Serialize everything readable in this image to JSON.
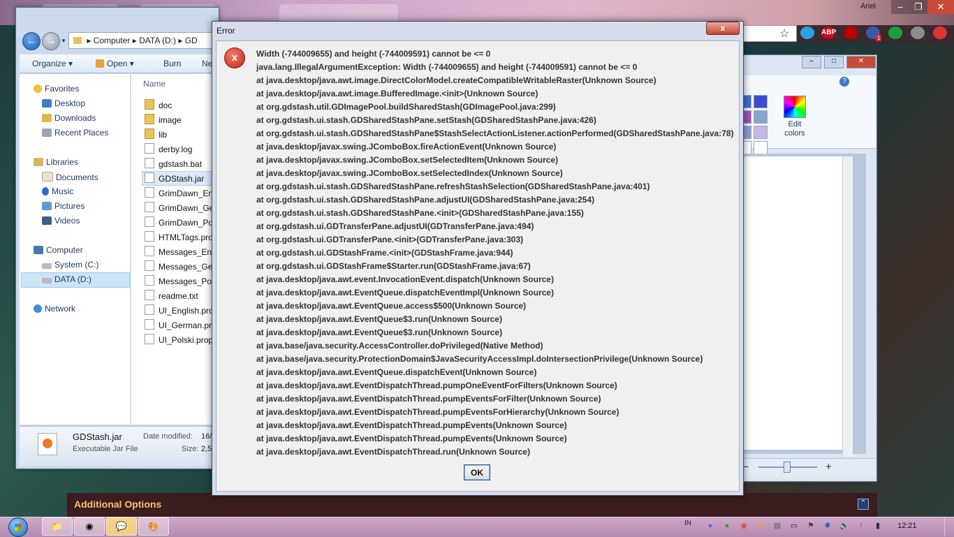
{
  "browser": {
    "tabs": [
      "",
      "",
      ""
    ],
    "account_name": "Ariel",
    "window_controls": [
      "–",
      "❐",
      "✕"
    ],
    "extensions": [
      {
        "name": "pinwheel-icon",
        "color": "#2aa1e0",
        "glyph": ""
      },
      {
        "name": "adblock-plus-icon",
        "color": "#d0021b",
        "glyph": "ABP"
      },
      {
        "name": "ublock-icon",
        "color": "#b00",
        "glyph": ""
      },
      {
        "name": "shield-icon",
        "color": "#3a5aa8",
        "glyph": ""
      },
      {
        "name": "play-icon",
        "color": "#1b9e3a",
        "glyph": ""
      },
      {
        "name": "cloud-icon",
        "color": "#8c8c8c",
        "glyph": ""
      },
      {
        "name": "arrow-up-icon",
        "color": "#d33",
        "glyph": ""
      }
    ],
    "badge_count": "1",
    "star": "☆"
  },
  "paint": {
    "controls": [
      "–",
      "□",
      "✕"
    ],
    "edit_colors_label": "Edit colors",
    "swatches": [
      "#3d6fd6",
      "#3c4ed0",
      "#a54ebd",
      "#84a6c8",
      "#8fa0d0",
      "#c7b8e3",
      "#ffffff",
      "#ffffff",
      "#ffffff"
    ],
    "zoom_minus": "−",
    "zoom_plus": "+"
  },
  "page": {
    "additional_options": "Additional Options"
  },
  "explorer": {
    "breadcrumb": [
      "Computer",
      "DATA (D:)",
      "GD"
    ],
    "toolbar": [
      "Organize",
      "Open",
      "Burn",
      "Ne"
    ],
    "nav": {
      "favorites": "Favorites",
      "favorites_items": [
        "Desktop",
        "Downloads",
        "Recent Places"
      ],
      "libraries": "Libraries",
      "libraries_items": [
        "Documents",
        "Music",
        "Pictures",
        "Videos"
      ],
      "computer": "Computer",
      "computer_items": [
        "System (C:)",
        "DATA (D:)"
      ],
      "network": "Network"
    },
    "column_header": "Name",
    "files": [
      {
        "name": "doc",
        "folder": true
      },
      {
        "name": "image",
        "folder": true
      },
      {
        "name": "lib",
        "folder": true
      },
      {
        "name": "derby.log",
        "folder": false
      },
      {
        "name": "gdstash.bat",
        "folder": false
      },
      {
        "name": "GDStash.jar",
        "folder": false
      },
      {
        "name": "GrimDawn_Eng",
        "folder": false
      },
      {
        "name": "GrimDawn_Ge",
        "folder": false
      },
      {
        "name": "GrimDawn_Po",
        "folder": false
      },
      {
        "name": "HTMLTags.pro",
        "folder": false
      },
      {
        "name": "Messages_Eng",
        "folder": false
      },
      {
        "name": "Messages_Ger",
        "folder": false
      },
      {
        "name": "Messages_Pols",
        "folder": false
      },
      {
        "name": "readme.txt",
        "folder": false
      },
      {
        "name": "UI_English.pro",
        "folder": false
      },
      {
        "name": "UI_German.pro",
        "folder": false
      },
      {
        "name": "UI_Polski.prop",
        "folder": false
      }
    ],
    "details": {
      "file_name": "GDStash.jar",
      "file_type": "Executable Jar File",
      "date_label": "Date modified:",
      "date_value": "16/",
      "size_label": "Size:",
      "size_value": "2,5"
    }
  },
  "dialog": {
    "title": "Error",
    "close": "x",
    "icon": "x",
    "lines": [
      "Width (-744009655) and height (-744009591) cannot be <= 0",
      "java.lang.IllegalArgumentException: Width (-744009655) and height (-744009591) cannot be <= 0",
      "at java.desktop/java.awt.image.DirectColorModel.createCompatibleWritableRaster(Unknown Source)",
      "at java.desktop/java.awt.image.BufferedImage.<init>(Unknown Source)",
      "at org.gdstash.util.GDImagePool.buildSharedStash(GDImagePool.java:299)",
      "at org.gdstash.ui.stash.GDSharedStashPane.setStash(GDSharedStashPane.java:426)",
      "at org.gdstash.ui.stash.GDSharedStashPane$StashSelectActionListener.actionPerformed(GDSharedStashPane.java:78)",
      "at java.desktop/javax.swing.JComboBox.fireActionEvent(Unknown Source)",
      "at java.desktop/javax.swing.JComboBox.setSelectedItem(Unknown Source)",
      "at java.desktop/javax.swing.JComboBox.setSelectedIndex(Unknown Source)",
      "at org.gdstash.ui.stash.GDSharedStashPane.refreshStashSelection(GDSharedStashPane.java:401)",
      "at org.gdstash.ui.stash.GDSharedStashPane.adjustUI(GDSharedStashPane.java:254)",
      "at org.gdstash.ui.stash.GDSharedStashPane.<init>(GDSharedStashPane.java:155)",
      "at org.gdstash.ui.GDTransferPane.adjustUI(GDTransferPane.java:494)",
      "at org.gdstash.ui.GDTransferPane.<init>(GDTransferPane.java:303)",
      "at org.gdstash.ui.GDStashFrame.<init>(GDStashFrame.java:944)",
      "at org.gdstash.ui.GDStashFrame$Starter.run(GDStashFrame.java:67)",
      "at java.desktop/java.awt.event.InvocationEvent.dispatch(Unknown Source)",
      "at java.desktop/java.awt.EventQueue.dispatchEventImpl(Unknown Source)",
      "at java.desktop/java.awt.EventQueue.access$500(Unknown Source)",
      "at java.desktop/java.awt.EventQueue$3.run(Unknown Source)",
      "at java.desktop/java.awt.EventQueue$3.run(Unknown Source)",
      "at java.base/java.security.AccessController.doPrivileged(Native Method)",
      "at java.base/java.security.ProtectionDomain$JavaSecurityAccessImpl.doIntersectionPrivilege(Unknown Source)",
      "at java.desktop/java.awt.EventQueue.dispatchEvent(Unknown Source)",
      "at java.desktop/java.awt.EventDispatchThread.pumpOneEventForFilters(Unknown Source)",
      "at java.desktop/java.awt.EventDispatchThread.pumpEventsForFilter(Unknown Source)",
      "at java.desktop/java.awt.EventDispatchThread.pumpEventsForHierarchy(Unknown Source)",
      "at java.desktop/java.awt.EventDispatchThread.pumpEvents(Unknown Source)",
      "at java.desktop/java.awt.EventDispatchThread.pumpEvents(Unknown Source)",
      "at java.desktop/java.awt.EventDispatchThread.run(Unknown Source)"
    ],
    "ok_label": "OK"
  },
  "taskbar": {
    "apps": [
      {
        "name": "explorer-taskbar-button",
        "glyph": "📁"
      },
      {
        "name": "chrome-taskbar-button",
        "glyph": "◉"
      },
      {
        "name": "chat-taskbar-button",
        "glyph": "💬"
      },
      {
        "name": "paint-taskbar-button",
        "glyph": "🎨"
      }
    ],
    "language": "IN",
    "tray": [
      "discord-icon",
      "chat-icon",
      "chrome-icon",
      "update-icon",
      "usb-icon",
      "monitor-icon",
      "flag-icon",
      "bluetooth-icon",
      "volume-icon",
      "alert-icon",
      "signal-icon"
    ],
    "time": "12:21"
  }
}
